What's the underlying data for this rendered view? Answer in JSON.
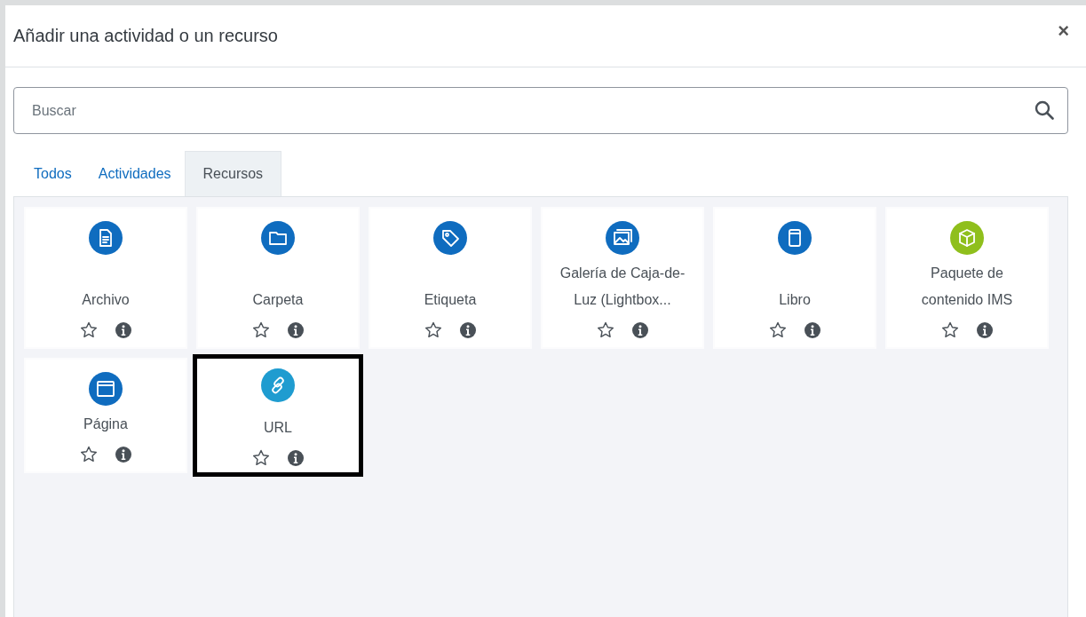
{
  "dialog": {
    "title": "Añadir una actividad o un recurso",
    "close": "×"
  },
  "search": {
    "placeholder": "Buscar"
  },
  "tabs": [
    {
      "label": "Todos",
      "selected": false
    },
    {
      "label": "Actividades",
      "selected": false
    },
    {
      "label": "Recursos",
      "selected": true
    }
  ],
  "items": [
    {
      "name": "Archivo",
      "kind": "file",
      "color": "#0f6cbf",
      "highlighted": false
    },
    {
      "name": "Carpeta",
      "kind": "folder",
      "color": "#0f6cbf",
      "highlighted": false
    },
    {
      "name": "Etiqueta",
      "kind": "tag",
      "color": "#0f6cbf",
      "highlighted": false
    },
    {
      "name": "Galería de Caja-de-Luz (Lightbox...",
      "kind": "gallery",
      "color": "#0f6cbf",
      "highlighted": false
    },
    {
      "name": "Libro",
      "kind": "book",
      "color": "#0f6cbf",
      "highlighted": false
    },
    {
      "name": "Paquete de contenido IMS",
      "kind": "package",
      "color": "#8fbf1c",
      "highlighted": false
    },
    {
      "name": "Página",
      "kind": "page",
      "color": "#0f6cbf",
      "highlighted": false
    },
    {
      "name": "URL",
      "kind": "url",
      "color": "#1f9cd0",
      "highlighted": true
    }
  ]
}
